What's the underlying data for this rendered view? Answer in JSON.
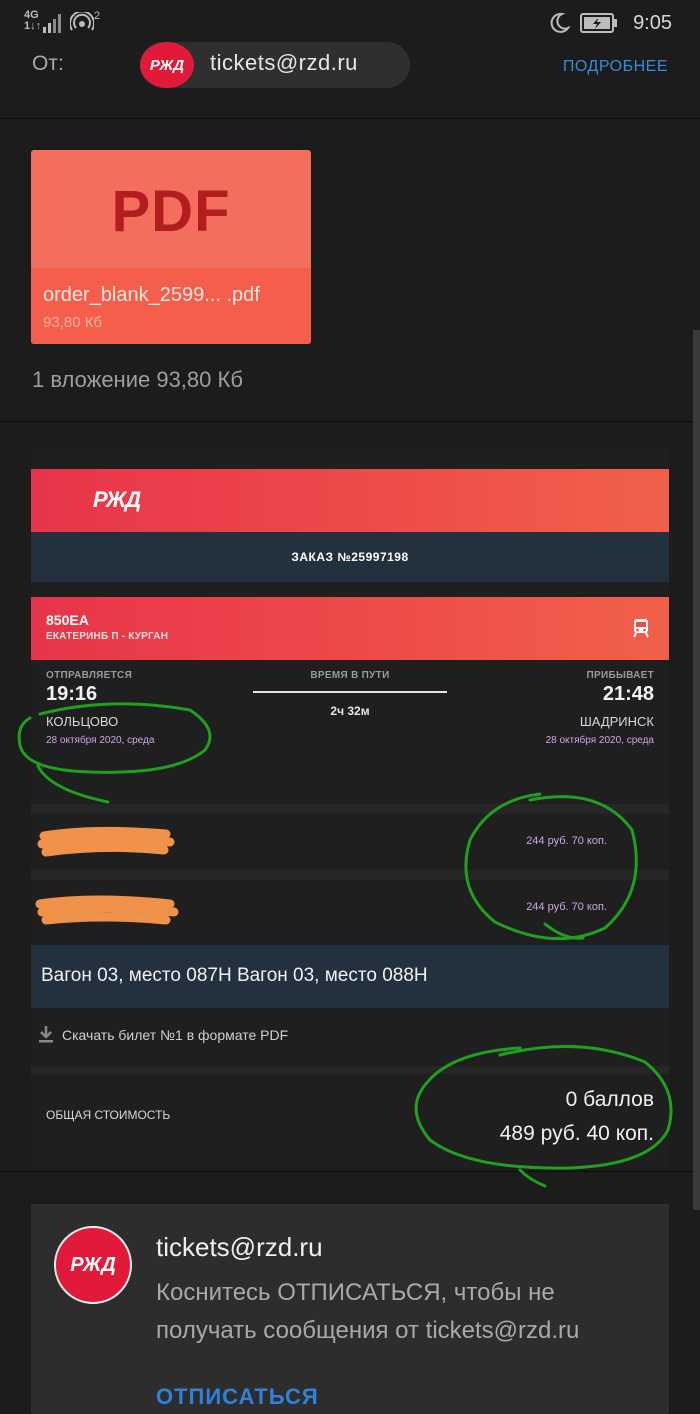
{
  "status_bar": {
    "network": "4G",
    "signal_sub": "1↓↑",
    "hotspot_count": "2",
    "time": "9:05"
  },
  "from_row": {
    "label": "От:",
    "sender": "tickets@rzd.ru",
    "more": "ПОДРОБНЕЕ"
  },
  "logo_text": "РЖД",
  "attachment": {
    "type_label": "PDF",
    "filename": "order_blank_2599... .pdf",
    "size": "93,80 Кб",
    "summary": "1 вложение 93,80 Кб"
  },
  "order": {
    "title": "ЗАКАЗ №25997198",
    "train_number": "850ЕА",
    "route": "ЕКАТЕРИНБ П - КУРГАН",
    "departs_label": "ОТПРАВЛЯЕТСЯ",
    "departs_time": "19:16",
    "departs_station": "КОЛЬЦОВО",
    "departs_date": "28 октября 2020, среда",
    "travel_label": "ВРЕМЯ В ПУТИ",
    "travel_time": "2ч 32м",
    "arrives_label": "ПРИБЫВАЕТ",
    "arrives_time": "21:48",
    "arrives_station": "ШАДРИНСК",
    "arrives_date": "28 октября 2020, среда",
    "passengers": [
      {
        "price": "244 руб. 70 коп."
      },
      {
        "price": "244 руб. 70 коп."
      }
    ],
    "seats": "Вагон 03, место 087Н Вагон 03, место 088Н",
    "download": "Скачать билет №1 в формате PDF",
    "total_label": "ОБЩАЯ СТОИМОСТЬ",
    "points": "0 баллов",
    "total": "489 руб. 40 коп."
  },
  "unsubscribe": {
    "sender": "tickets@rzd.ru",
    "message": "Коснитесь ОТПИСАТЬСЯ, чтобы не получать сообщения от tickets@rzd.ru",
    "link": "ОТПИСАТЬСЯ"
  },
  "colors": {
    "brand_red": "#e21a3a",
    "dark_navy": "#23313f",
    "link_blue": "#3a8bdb",
    "date_purple": "#c9a8e6",
    "annotation_green": "#1fa01f",
    "redaction_orange": "#f0924a"
  }
}
